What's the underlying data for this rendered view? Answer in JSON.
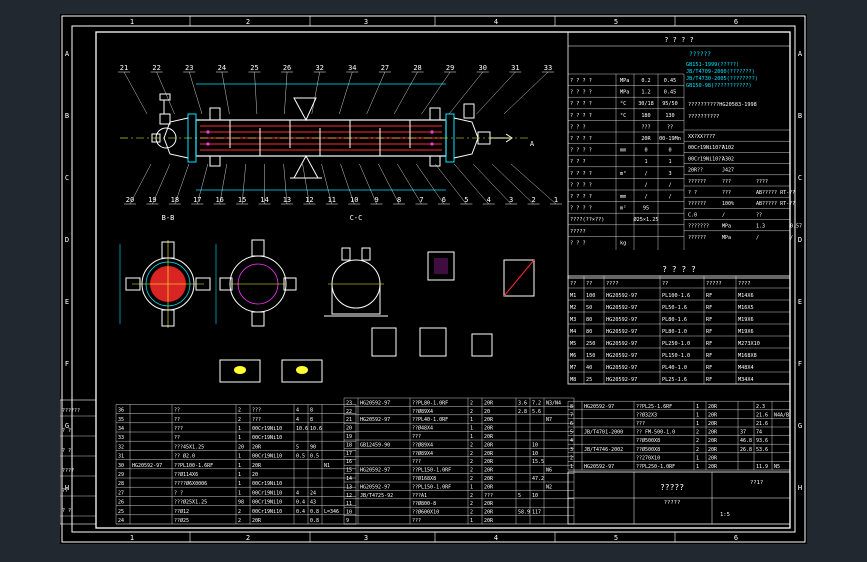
{
  "colors": {
    "frame": "#ffffff",
    "cyan": "#00e5ff",
    "red": "#ff2a2a",
    "yellow": "#ffff33",
    "green": "#33ff66",
    "magenta": "#ff33ff",
    "lines": "#ffffff"
  },
  "col_numbers": [
    "1",
    "2",
    "3",
    "4",
    "5",
    "6"
  ],
  "row_letters": [
    "A",
    "B",
    "C",
    "D",
    "E",
    "F",
    "G",
    "H"
  ],
  "balloons_top": [
    "21",
    "22",
    "23",
    "24",
    "25",
    "26",
    "32",
    "34",
    "27",
    "28",
    "29",
    "30",
    "31",
    "33"
  ],
  "balloons_bottom": [
    "20",
    "19",
    "18",
    "17",
    "16",
    "15",
    "14",
    "13",
    "12",
    "11",
    "10",
    "9",
    "8",
    "7",
    "6",
    "5",
    "4",
    "3",
    "2",
    "1"
  ],
  "view_labels": [
    "B-B",
    "C-C",
    "A"
  ],
  "tech_header": "? ?  ? ?",
  "tech_title": "??????",
  "standards": [
    "GB151-1999(?????)",
    "JB/T4709-2000(???????)",
    "JB/T4730-2005(????????)",
    "GB150-98(???????????)"
  ],
  "design_params": [
    {
      "name": "? ? ? ?",
      "unit": "MPa",
      "a": "0.2",
      "b": "0.45"
    },
    {
      "name": "? ? ? ?",
      "unit": "MPa",
      "a": "1.2",
      "b": "0.45"
    },
    {
      "name": "? ? ? ?",
      "unit": "°C",
      "a": "30/18",
      "b": "95/50"
    },
    {
      "name": "? ? ? ?",
      "unit": "°C",
      "a": "180",
      "b": "130"
    },
    {
      "name": "? ? ?",
      "unit": "",
      "a": "???",
      "b": "??"
    },
    {
      "name": "? ? ? ?",
      "unit": "",
      "a": "20R",
      "b": "00-19Mn"
    },
    {
      "name": "? ? ? ?",
      "unit": "mm",
      "a": "0",
      "b": "0"
    },
    {
      "name": "? ? ?",
      "unit": "",
      "a": "1",
      "b": "1"
    },
    {
      "name": "? ? ? ?",
      "unit": "m³",
      "a": "/",
      "b": "3"
    },
    {
      "name": "? ? ? ?",
      "unit": "",
      "a": "/",
      "b": "/"
    },
    {
      "name": "? ? ? ?",
      "unit": "mm",
      "a": "/",
      "b": "/"
    },
    {
      "name": "? ? ? ?",
      "unit": "m²",
      "a": "95",
      "b": ""
    },
    {
      "name": "????(??×??)",
      "unit": "",
      "a": "Ø25×1.25",
      "b": ""
    },
    {
      "name": "?????",
      "unit": "",
      "a": "",
      "b": ""
    },
    {
      "name": "? ? ?",
      "unit": "kg",
      "a": "",
      "b": ""
    }
  ],
  "right_notes": [
    "??????????HG20583-1998",
    "??????????"
  ],
  "right_grid": [
    [
      "XX?XX?7?7",
      "",
      ""
    ],
    [
      "00Cr19Ni10??",
      "A102",
      ""
    ],
    [
      "00Cr19Ni10??",
      "A302",
      ""
    ],
    [
      "20R??",
      "J427",
      ""
    ],
    [
      "??????",
      "???",
      "????"
    ],
    [
      "? ?",
      "???",
      "AB????? RT-??"
    ],
    [
      "??????",
      "100%",
      "AB????? RT-??"
    ],
    [
      "C.0",
      "/",
      "??"
    ],
    [
      "???????",
      "MPa",
      "1.3",
      "0.57"
    ],
    [
      "??????",
      "MPa",
      "/",
      "/"
    ]
  ],
  "nozzle_title": "? ? ? ?",
  "nozzle_header": [
    "??",
    "??",
    "????",
    "??",
    "?????",
    "????"
  ],
  "nozzles": [
    [
      "M1",
      "100",
      "HG20592-97",
      "PL100-1.6",
      "RF",
      "M14X6"
    ],
    [
      "M2",
      "50",
      "HG20592-97",
      "PL50-1.6",
      "RF",
      "??",
      "M16X5"
    ],
    [
      "M3",
      "80",
      "HG20592-97",
      "PL80-1.6",
      "RF",
      "????",
      "M19X6"
    ],
    [
      "M4",
      "80",
      "HG20592-97",
      "PL80-1.0",
      "RF",
      "?????",
      "M19X6"
    ],
    [
      "M5",
      "250",
      "HG20592-97",
      "PL250-1.0",
      "RF",
      "????",
      "M273X10"
    ],
    [
      "M6",
      "150",
      "HG20592-97",
      "PL150-1.0",
      "RF",
      "??????",
      "M168X8"
    ],
    [
      "M7",
      "40",
      "HG20592-97",
      "PL40-1.0",
      "RF",
      "??",
      "M48X4"
    ],
    [
      "M8",
      "25",
      "HG20592-97",
      "PL25-1.6",
      "RF",
      "?????",
      "M34X4"
    ]
  ],
  "bom_left": [
    [
      "36",
      "",
      "??",
      "2",
      "???",
      "4",
      "8",
      ""
    ],
    [
      "35",
      "",
      "??",
      "2",
      "???",
      "4",
      "8",
      ""
    ],
    [
      "34",
      "",
      "???",
      "1",
      "00Cr19Ni10",
      "10.6",
      "10.6",
      ""
    ],
    [
      "33",
      "",
      "??",
      "1",
      "00Cr19Ni10",
      "",
      "",
      ""
    ],
    [
      "32",
      "",
      "???45X1.25",
      "20",
      "20R",
      "5",
      "90",
      ""
    ],
    [
      "31",
      "",
      "?? Ø2.0",
      "1",
      "00Cr19Ni10",
      "0.5",
      "0.5",
      ""
    ],
    [
      "30",
      "HG20592-97",
      "??PL100-1.6RF",
      "1",
      "20R",
      "",
      "",
      "N1"
    ],
    [
      "29",
      "",
      "??Ø114X6",
      "1",
      "20",
      "",
      "",
      ""
    ],
    [
      "28",
      "",
      "????Ø6X0006",
      "1",
      "00Cr19Ni10",
      "",
      "",
      ""
    ],
    [
      "27",
      "",
      "?  ?",
      "1",
      "00Cr19Ni10",
      "4",
      "24",
      ""
    ],
    [
      "26",
      "",
      "???Ø25X1.25",
      "98",
      "00Cr19Ni10",
      "0.4",
      "43",
      ""
    ],
    [
      "25",
      "",
      "??Ø12",
      "2",
      "00Cr19Ni10",
      "0.4",
      "0.8",
      "L=346"
    ],
    [
      "24",
      "",
      "??Ø25",
      "2",
      "20R",
      "",
      "0.8",
      ""
    ]
  ],
  "bom_mid": [
    [
      "23",
      "HG20592-97",
      "??PL80-1.0RF",
      "2",
      "20R",
      "3.6",
      "7.2",
      "N3/N4"
    ],
    [
      "22",
      "",
      "??Ø89X4",
      "2",
      "20",
      "2.8",
      "5.6",
      ""
    ],
    [
      "21",
      "HG20592-97",
      "??PL40-1.0RF",
      "1",
      "20R",
      "",
      "",
      "N7"
    ],
    [
      "20",
      "",
      "??Ø48X4",
      "1",
      "20R",
      "",
      "",
      ""
    ],
    [
      "19",
      "",
      "???",
      "1",
      "20R",
      "",
      "",
      ""
    ],
    [
      "18",
      "GB12459-90",
      "??Ø89X4",
      "2",
      "20R",
      "",
      "10",
      ""
    ],
    [
      "17",
      "",
      "??Ø89X4",
      "2",
      "20R",
      "",
      "10",
      ""
    ],
    [
      "16",
      "",
      "???",
      "2",
      "20R",
      "",
      "15.5",
      ""
    ],
    [
      "15",
      "HG20592-97",
      "??PL150-1.0RF",
      "2",
      "20R",
      "",
      "",
      "N6"
    ],
    [
      "14",
      "",
      "??Ø168X8",
      "2",
      "20R",
      "",
      "47.2",
      ""
    ],
    [
      "13",
      "HG20592-97",
      "??PL150-1.0RF",
      "1",
      "20R",
      "",
      "",
      "N2"
    ],
    [
      "12",
      "JB/T4725-92",
      "???A1",
      "2",
      "???",
      "5",
      "10",
      ""
    ],
    [
      "11",
      "",
      "??Ø800-8",
      "2",
      "20R",
      "",
      "",
      ""
    ],
    [
      "10",
      "",
      "??Ø600X10",
      "2",
      "20R",
      "58.9",
      "117",
      ""
    ],
    [
      "9",
      "",
      "???",
      "1",
      "20R",
      "",
      "",
      ""
    ]
  ],
  "bom_right": [
    [
      "8",
      "HG20592-97",
      "??PL25-1.6RF",
      "1",
      "20R",
      "",
      "2.3",
      ""
    ],
    [
      "7",
      "",
      "??Ø32X3",
      "1",
      "20R",
      "",
      "21.6",
      "N4A/B"
    ],
    [
      "6",
      "",
      "???",
      "1",
      "20R",
      "",
      "21.6",
      ""
    ],
    [
      "5",
      "JB/T4701-2000",
      "?? FM-500-1.0",
      "2",
      "20R",
      "37",
      "74",
      ""
    ],
    [
      "4",
      "",
      "??Ø500X8",
      "2",
      "20R",
      "46.8",
      "93.6",
      ""
    ],
    [
      "3",
      "JB/T4746-2002",
      "??Ø500X8",
      "2",
      "20R",
      "26.8",
      "53.6",
      ""
    ],
    [
      "2",
      "",
      "??270X10",
      "1",
      "20R",
      "",
      "",
      ""
    ],
    [
      "1",
      "HG20592-97",
      "??PL250-1.0RF",
      "1",
      "20R",
      "",
      "11.9",
      "N5"
    ]
  ],
  "title_block": {
    "title": "?????",
    "dwg_no": "?????",
    "scale": "1:5",
    "sheet": "??1?"
  },
  "left_strip": [
    "??????",
    "?  ?",
    "?  ?",
    "????",
    "??",
    "?  ?"
  ]
}
